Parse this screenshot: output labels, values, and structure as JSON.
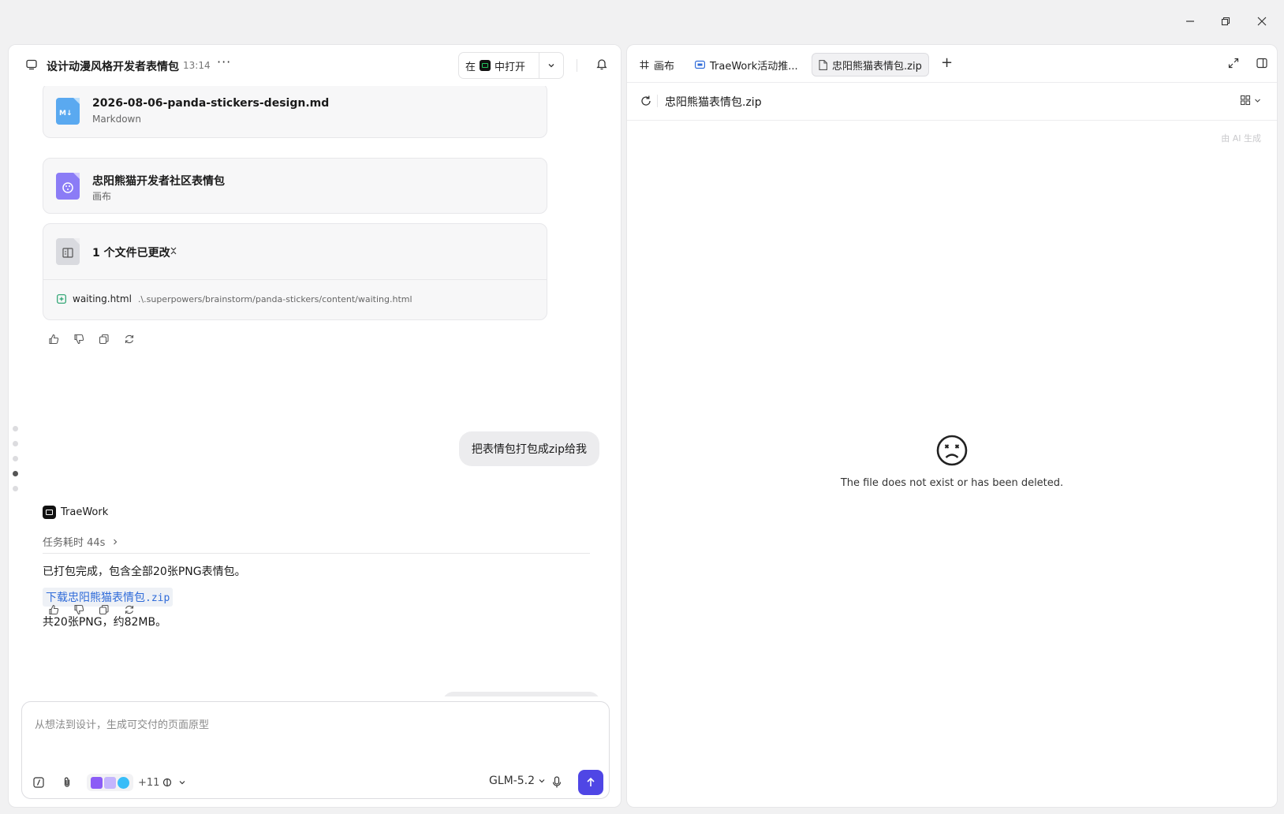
{
  "window": {
    "minimize_icon": "minimize-icon",
    "maximize_icon": "restore-icon",
    "close_icon": "close-icon"
  },
  "conversation": {
    "title": "设计动漫风格开发者表情包",
    "time": "13:14",
    "more": "···",
    "open_in_prefix": "在",
    "open_in_suffix": "中打开"
  },
  "files": [
    {
      "name": "2026-08-06-panda-stickers-design.md",
      "type": "Markdown",
      "icon": "markdown-file-icon"
    },
    {
      "name": "忠阳熊猫开发者社区表情包",
      "type": "画布",
      "icon": "canvas-file-icon"
    }
  ],
  "changes": {
    "title": "1 个文件已更改",
    "file_name": "waiting.html",
    "file_path": ".\\.superpowers/brainstorm/panda-stickers/content/waiting.html"
  },
  "user_message": "把表情包打包成zip给我",
  "agent": {
    "name": "TraeWork",
    "duration": "任务耗时 44s",
    "reply_line1": "已打包完成，包含全部20张PNG表情包。",
    "link_prefix": "下载",
    "link_name": "忠阳熊猫表情包",
    "link_ext": ".zip",
    "reply_line2": "共20张PNG，约82MB。"
  },
  "composer": {
    "placeholder": "从想法到设计，生成可交付的页面原型",
    "more_tools": "+11",
    "model": "GLM-5.2"
  },
  "right_panel": {
    "tabs": [
      {
        "label": "画布",
        "icon": "frame-icon"
      },
      {
        "label": "TraeWork活动推...",
        "icon": "app-icon"
      },
      {
        "label": "忠阳熊猫表情包.zip",
        "icon": "file-icon"
      }
    ],
    "add_tab": "+",
    "file_name": "忠阳熊猫表情包.zip",
    "ai_generated": "由 AI 生成",
    "empty_message": "The file does not exist or has been deleted."
  },
  "colors": {
    "accent": "#4f46e5",
    "link": "#2f6bd9",
    "added_file": "#22a06b",
    "markdown_icon": "#5aa9f0",
    "canvas_icon": "#8b7cf6"
  }
}
